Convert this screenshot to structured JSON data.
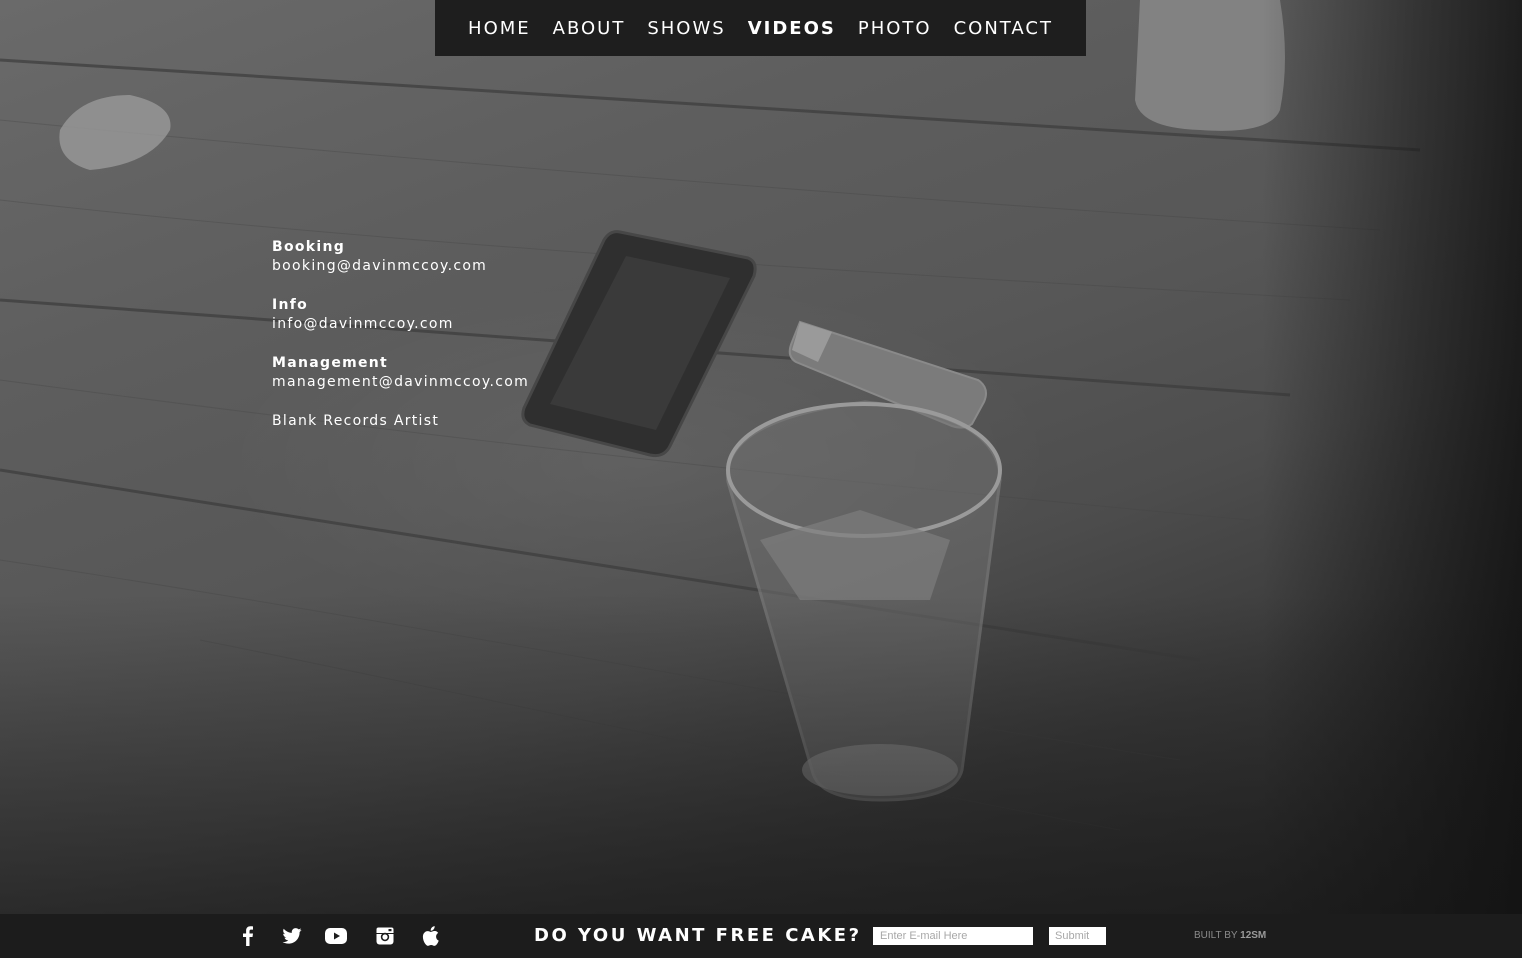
{
  "nav": {
    "items": [
      {
        "label": "HOME"
      },
      {
        "label": "ABOUT"
      },
      {
        "label": "SHOWS"
      },
      {
        "label": "VIDEOS"
      },
      {
        "label": "PHOTO"
      },
      {
        "label": "CONTACT"
      }
    ],
    "active": "VIDEOS"
  },
  "contact": {
    "booking": {
      "label": "Booking",
      "email": "booking@davinmccoy.com"
    },
    "info": {
      "label": "Info",
      "email": "info@davinmccoy.com"
    },
    "management": {
      "label": "Management",
      "email": "management@davinmccoy.com"
    },
    "note": "Blank Records Artist"
  },
  "footer": {
    "social_icons": [
      "facebook-icon",
      "twitter-icon",
      "youtube-icon",
      "instagram-icon",
      "apple-icon"
    ],
    "cake_heading": "DO YOU WANT FREE CAKE?",
    "email_placeholder": "Enter E-mail Here",
    "submit_label": "Submit",
    "built_by_prefix": "BUILT BY",
    "built_by_name": "12SM"
  },
  "colors": {
    "nav_bg": "#1e1e1e",
    "footer_bg": "#1c1c1c",
    "text": "#ffffff"
  }
}
